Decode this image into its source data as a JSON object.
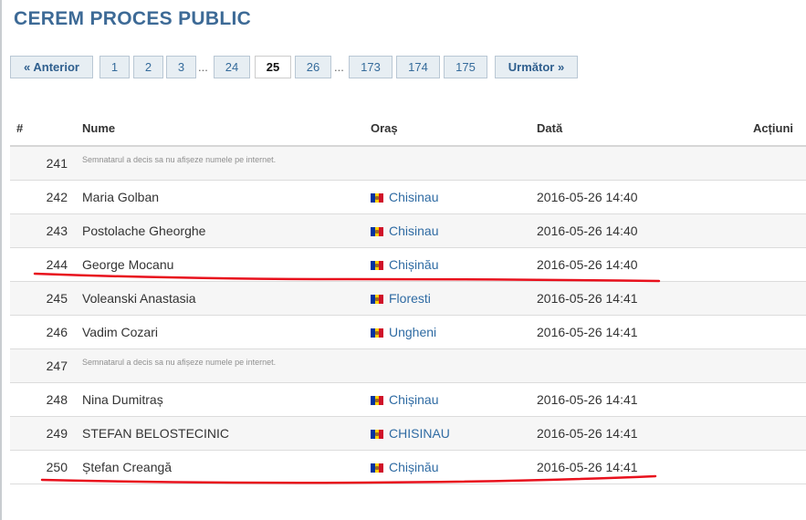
{
  "page": {
    "title": "CEREM PROCES PUBLIC"
  },
  "pagination": {
    "prev_label": "« Anterior",
    "next_label": "Următor »",
    "ellipsis": "...",
    "pages": [
      "1",
      "2",
      "3",
      "24",
      "25",
      "26",
      "173",
      "174",
      "175"
    ],
    "current": "25"
  },
  "table": {
    "headers": {
      "num": "#",
      "name": "Nume",
      "city": "Oraș",
      "date": "Dată",
      "actions": "Acțiuni"
    },
    "rows": [
      {
        "num": "241",
        "name": "",
        "note": "Semnatarul a decis sa nu afișeze numele pe internet.",
        "city": "",
        "date": ""
      },
      {
        "num": "242",
        "name": "Maria Golban",
        "note": "",
        "city": "Chisinau",
        "date": "2016-05-26 14:40"
      },
      {
        "num": "243",
        "name": "Postolache Gheorghe",
        "note": "",
        "city": "Chisinau",
        "date": "2016-05-26 14:40"
      },
      {
        "num": "244",
        "name": "George Mocanu",
        "note": "",
        "city": "Chișinău",
        "date": "2016-05-26 14:40"
      },
      {
        "num": "245",
        "name": "Voleanski Anastasia",
        "note": "",
        "city": "Floresti",
        "date": "2016-05-26 14:41"
      },
      {
        "num": "246",
        "name": "Vadim Cozari",
        "note": "",
        "city": "Ungheni",
        "date": "2016-05-26 14:41"
      },
      {
        "num": "247",
        "name": "",
        "note": "Semnatarul a decis sa nu afișeze numele pe internet.",
        "city": "",
        "date": ""
      },
      {
        "num": "248",
        "name": "Nina Dumitraș",
        "note": "",
        "city": "Chișinau",
        "date": "2016-05-26 14:41"
      },
      {
        "num": "249",
        "name": "STEFAN BELOSTECINIC",
        "note": "",
        "city": "CHISINAU",
        "date": "2016-05-26 14:41"
      },
      {
        "num": "250",
        "name": "Ștefan Creangă",
        "note": "",
        "city": "Chișinău",
        "date": "2016-05-26 14:41"
      }
    ]
  },
  "annotations": {
    "color": "#e8101c",
    "underlined_rows": [
      "244",
      "250"
    ]
  },
  "colors": {
    "title": "#3d6a96",
    "link": "#2f6ba3",
    "pager_bg": "#e7eef3",
    "pager_border": "#b9c7d4"
  }
}
